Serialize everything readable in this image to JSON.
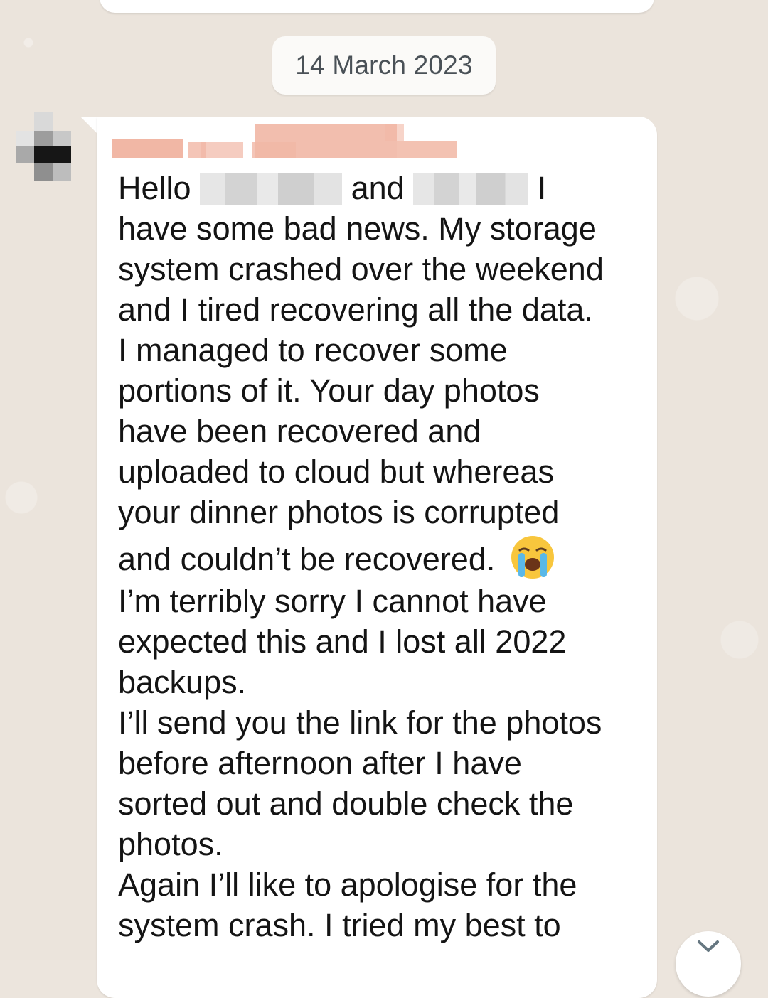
{
  "date_divider": "14 March 2023",
  "message": {
    "line_1": {
      "greeting": "Hello",
      "conjunction": "and",
      "end": "I"
    },
    "lines": [
      "have some bad news. My storage",
      "system crashed over the weekend",
      "and I tired recovering all the data.",
      "I managed to recover some",
      "portions of it. Your day photos",
      "have been recovered and",
      "uploaded to cloud but whereas",
      "your dinner photos is corrupted"
    ],
    "emoji_line": "and couldn’t be recovered.",
    "lines_after": [
      "I’m terribly sorry I cannot have",
      "expected this and I lost all 2022",
      "backups.",
      "I’ll send you the link for the photos",
      "before afternoon after I have",
      "sorted out and double check the",
      "photos.",
      "Again I’ll like to apologise for the",
      "system crash. I tried my best to"
    ]
  },
  "icons": {
    "emoji": "loudly-crying-face-icon",
    "scroll": "chevron-down-icon"
  },
  "colors": {
    "wallpaper": "#ebe4dc",
    "bubble": "#ffffff",
    "text": "#141414",
    "sender_name_blur": "#f1b7a5"
  }
}
